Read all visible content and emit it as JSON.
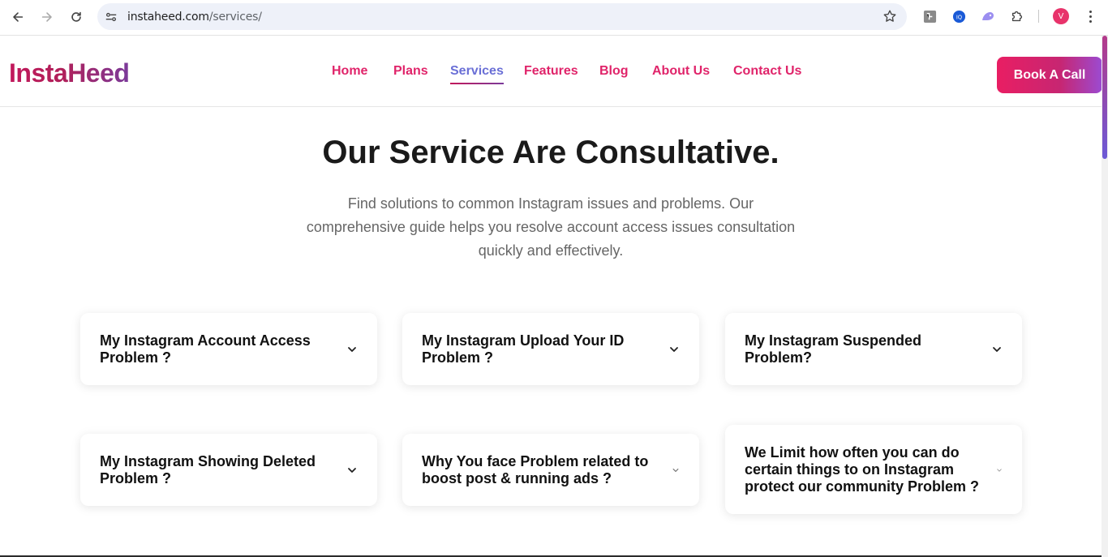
{
  "browser": {
    "url_host": "instaheed.com",
    "url_path": "/services/",
    "avatar_letter": "V"
  },
  "header": {
    "logo": "InstaHeed",
    "nav": [
      "Home",
      "Plans",
      "Services",
      "Features",
      "Blog",
      "About Us",
      "Contact Us"
    ],
    "active_nav": "Services",
    "cta": "Book A Call"
  },
  "hero": {
    "title": "Our Service Are Consultative.",
    "subtitle_lines": [
      "Find solutions to common Instagram issues and problems. Our",
      "comprehensive guide helps you resolve account access issues consultation",
      "quickly and effectively."
    ]
  },
  "faq": [
    {
      "q_lines": [
        "My Instagram Account Access",
        "Problem ?"
      ]
    },
    {
      "q_lines": [
        "My Instagram Upload Your ID",
        "Problem ?"
      ]
    },
    {
      "q_lines": [
        "My Instagram Suspended",
        "Problem?"
      ]
    },
    {
      "q_lines": [
        "My Instagram Showing Deleted",
        "Problem ?"
      ]
    },
    {
      "q_lines": [
        "Why You face Problem related to",
        "boost post & running ads ?"
      ]
    },
    {
      "q_lines": [
        "We Limit how often you can do",
        "certain things to on Instagram",
        "protect our community Problem ?"
      ]
    }
  ],
  "colors": {
    "brand_pink": "#e0246a",
    "active_nav": "#6a6fd6",
    "cta_start": "#e91e63",
    "cta_end": "#9b4bd2"
  }
}
